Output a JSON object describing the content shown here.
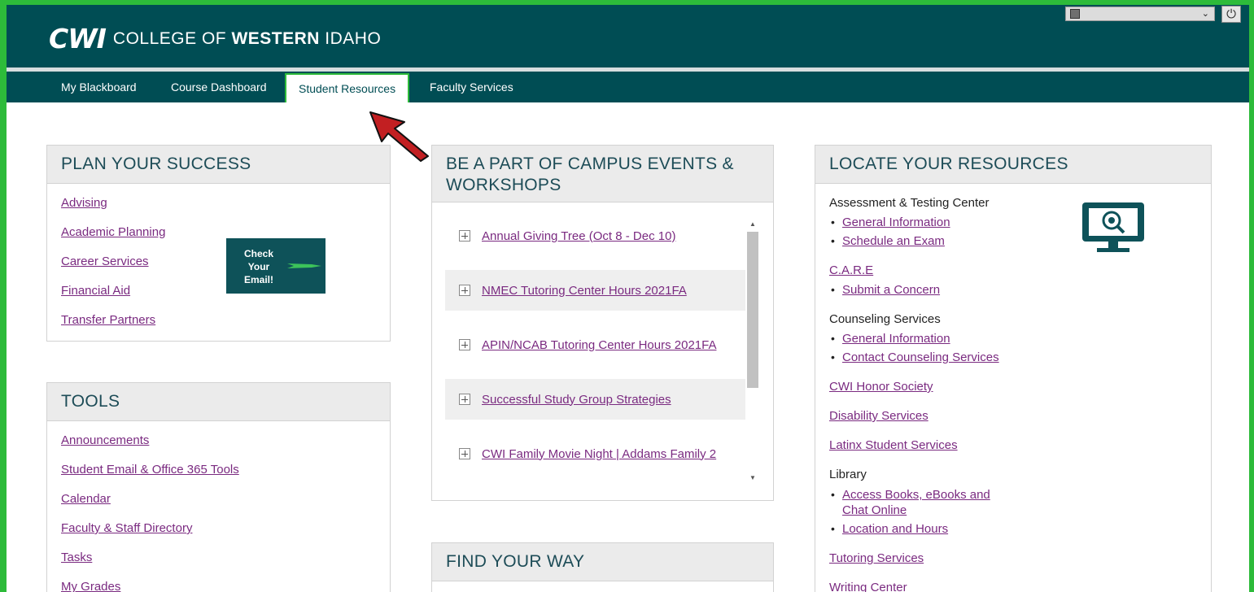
{
  "header": {
    "logo_mark": "CWI",
    "logo_prefix": "COLLEGE OF ",
    "logo_bold": "WESTERN",
    "logo_suffix": " IDAHO"
  },
  "nav": {
    "tabs": [
      {
        "label": "My Blackboard"
      },
      {
        "label": "Course Dashboard"
      },
      {
        "label": "Student Resources"
      },
      {
        "label": "Faculty Services"
      }
    ],
    "active_tab": "Student Resources"
  },
  "plan": {
    "title": "PLAN YOUR SUCCESS",
    "links": [
      "Advising",
      "Academic Planning",
      "Career Services",
      "Financial Aid",
      "Transfer Partners"
    ],
    "email_button": "Check Your Email!"
  },
  "tools": {
    "title": "TOOLS",
    "links": [
      "Announcements",
      "Student Email & Office 365 Tools",
      "Calendar",
      "Faculty & Staff Directory",
      "Tasks",
      "My Grades"
    ]
  },
  "events": {
    "title": "BE A PART OF CAMPUS EVENTS & WORKSHOPS",
    "items": [
      "Annual Giving Tree (Oct 8 - Dec 10)",
      "NMEC Tutoring Center Hours 2021FA",
      "APIN/NCAB Tutoring Center Hours 2021FA",
      "Successful Study Group Strategies",
      "CWI Family Movie Night | Addams Family 2"
    ]
  },
  "find": {
    "title": "FIND YOUR WAY"
  },
  "resources": {
    "title": "LOCATE YOUR RESOURCES",
    "assessment": "Assessment & Testing Center",
    "assessment_general": "General Information",
    "assessment_exam": "Schedule an Exam",
    "care": "C.A.R.E",
    "care_concern": "Submit a Concern",
    "counseling": "Counseling Services",
    "counseling_general": "General Information",
    "counseling_contact": "Contact Counseling Services",
    "honor": "CWI Honor Society",
    "disability": "Disability Services",
    "latinx": "Latinx Student Services",
    "library": "Library",
    "library_books_1": "Access Books, eBooks and",
    "library_books_2": "Chat Online",
    "library_location": "Location and Hours",
    "tutoring": "Tutoring Services",
    "writing": "Writing Center"
  },
  "colors": {
    "brand_teal": "#004d54",
    "accent_green": "#2dbb3a",
    "link_purple": "#7a2a80"
  }
}
